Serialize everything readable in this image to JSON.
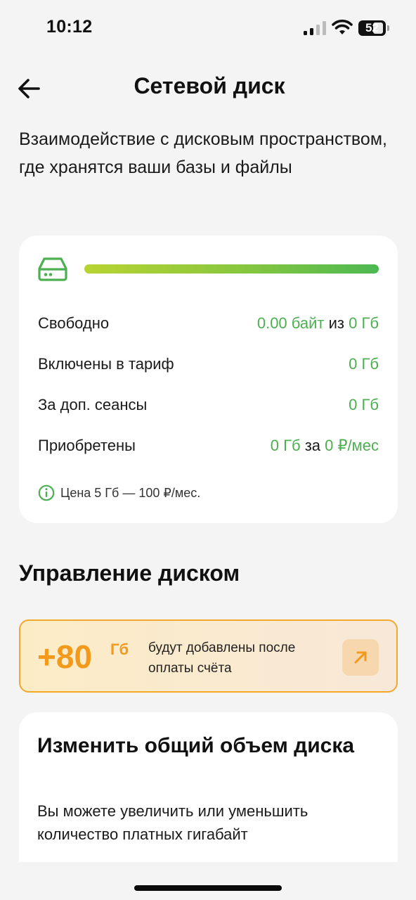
{
  "status_bar": {
    "time": "10:12",
    "battery": "52"
  },
  "header": {
    "title": "Сетевой диск"
  },
  "description": "Взаимодействие с дисковым пространством, где хранятся ваши базы и файлы",
  "disk": {
    "usage_fraction": 1.0,
    "rows": [
      {
        "label": "Свободно",
        "value_a": "0.00 байт",
        "sep": "из",
        "value_b": "0 Гб"
      },
      {
        "label": "Включены в тариф",
        "value": "0 Гб"
      },
      {
        "label": "За доп. сеансы",
        "value": "0 Гб"
      },
      {
        "label": "Приобретены",
        "value_a": "0 Гб",
        "sep": "за",
        "value_b": "0 ₽/мес"
      }
    ],
    "info": "Цена 5 Гб — 100 ₽/мес."
  },
  "management": {
    "title": "Управление диском",
    "promo": {
      "amount": "+80",
      "unit": "Гб",
      "text": "будут добавлены после оплаты счёта"
    },
    "change": {
      "title": "Изменить общий объем диска",
      "description": "Вы можете увеличить или уменьшить количество платных гигабайт"
    }
  },
  "colors": {
    "accent_green": "#4caf50",
    "accent_orange": "#f39a1d",
    "background": "#f4f4f4"
  },
  "icons": [
    "back-arrow-icon",
    "disk-icon",
    "info-icon",
    "arrow-up-right-icon",
    "wifi-icon",
    "signal-icon",
    "battery-icon"
  ]
}
